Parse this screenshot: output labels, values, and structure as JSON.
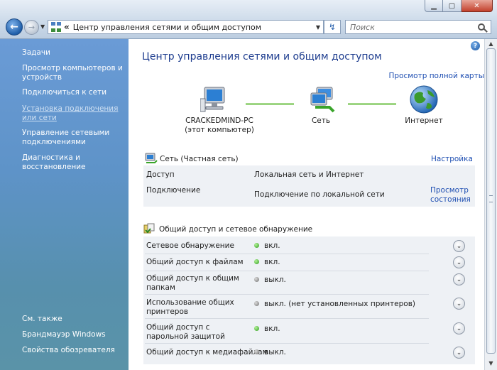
{
  "address": {
    "path": "Центр управления сетями и общим доступом",
    "sep": "«"
  },
  "search": {
    "placeholder": "Поиск"
  },
  "sidebar": {
    "tasks_heading": "Задачи",
    "items": [
      "Просмотр компьютеров и устройств",
      "Подключиться к сети",
      "Установка подключения или сети",
      "Управление сетевыми подключениями",
      "Диагностика и восстановление"
    ],
    "see_also": "См. также",
    "bottom": [
      "Брандмауэр Windows",
      "Свойства обозревателя"
    ]
  },
  "main": {
    "title": "Центр управления сетями и общим доступом",
    "full_map_link": "Просмотр полной карты",
    "nodes": {
      "computer": "CRACKEDMIND-PC",
      "computer_sub": "(этот компьютер)",
      "network": "Сеть",
      "internet": "Интернет"
    },
    "network_section": {
      "title": "Сеть (Частная сеть)",
      "settings_link": "Настройка",
      "access_label": "Доступ",
      "access_value": "Локальная сеть и Интернет",
      "connection_label": "Подключение",
      "connection_value": "Подключение по локальной сети",
      "status_link": "Просмотр состояния"
    },
    "sharing_section": {
      "title": "Общий доступ и сетевое обнаружение",
      "rows": [
        {
          "label": "Сетевое обнаружение",
          "status": "вкл.",
          "on": true
        },
        {
          "label": "Общий доступ к файлам",
          "status": "вкл.",
          "on": true
        },
        {
          "label": "Общий доступ к общим папкам",
          "status": "выкл.",
          "on": false
        },
        {
          "label": "Использование общих принтеров",
          "status": "выкл. (нет установленных принтеров)",
          "on": false
        },
        {
          "label": "Общий доступ с парольной защитой",
          "status": "вкл.",
          "on": true
        },
        {
          "label": "Общий доступ к медиафайлам",
          "status": "выкл.",
          "on": false
        }
      ]
    }
  }
}
